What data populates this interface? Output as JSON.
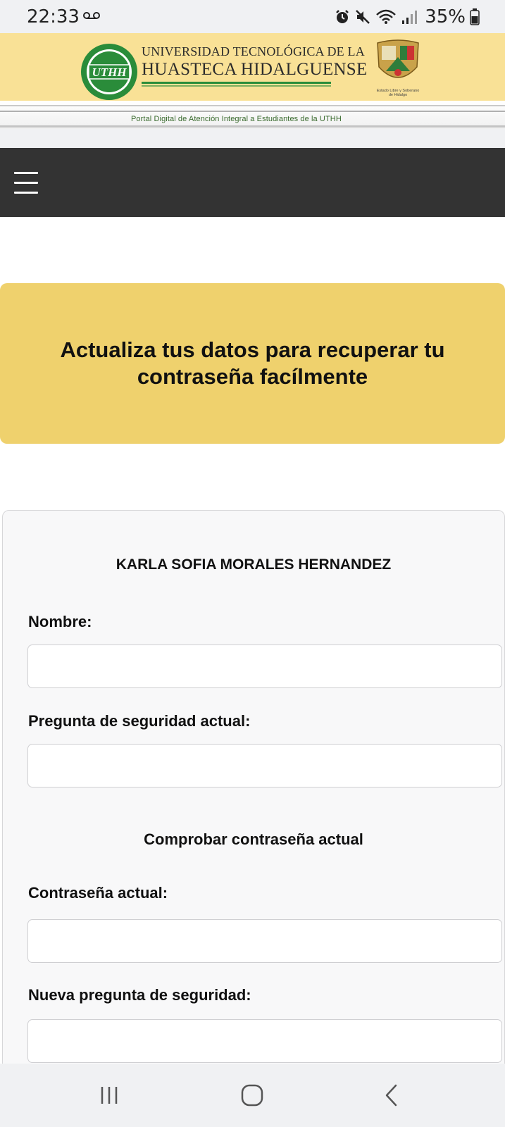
{
  "status_bar": {
    "time": "22:33",
    "battery": "35%"
  },
  "header": {
    "university_line1": "UNIVERSIDAD TECNOLÓGICA DE LA",
    "university_line2": "HUASTECA HIDALGUENSE",
    "logo_text": "UTHH",
    "coat_caption_line1": "Estado Libre y Soberano",
    "coat_caption_line2": "de Hidalgo",
    "portal_subtitle": "Portal Digital de Atención Integral a Estudiantes de la UTHH"
  },
  "banner_card": {
    "title": "Actualiza tus datos para recuperar tu contraseña facílmente"
  },
  "form": {
    "student_name": "KARLA SOFIA MORALES HERNANDEZ",
    "fields": [
      {
        "label": "Nombre:",
        "value": ""
      },
      {
        "label": "Pregunta de seguridad actual:",
        "value": ""
      },
      {
        "label": "Contraseña actual:",
        "value": ""
      },
      {
        "label": "Nueva pregunta de seguridad:",
        "value": ""
      }
    ],
    "check_password_heading": "Comprobar contraseña actual"
  },
  "colors": {
    "banner_bg": "#f9e196",
    "accent_yellow": "#efd16d",
    "navbar_bg": "#333333",
    "logo_green": "#2a8c3a"
  },
  "icons": {
    "menu": "hamburger-icon",
    "recents": "recent-apps-icon",
    "home": "home-icon",
    "back": "back-icon"
  }
}
